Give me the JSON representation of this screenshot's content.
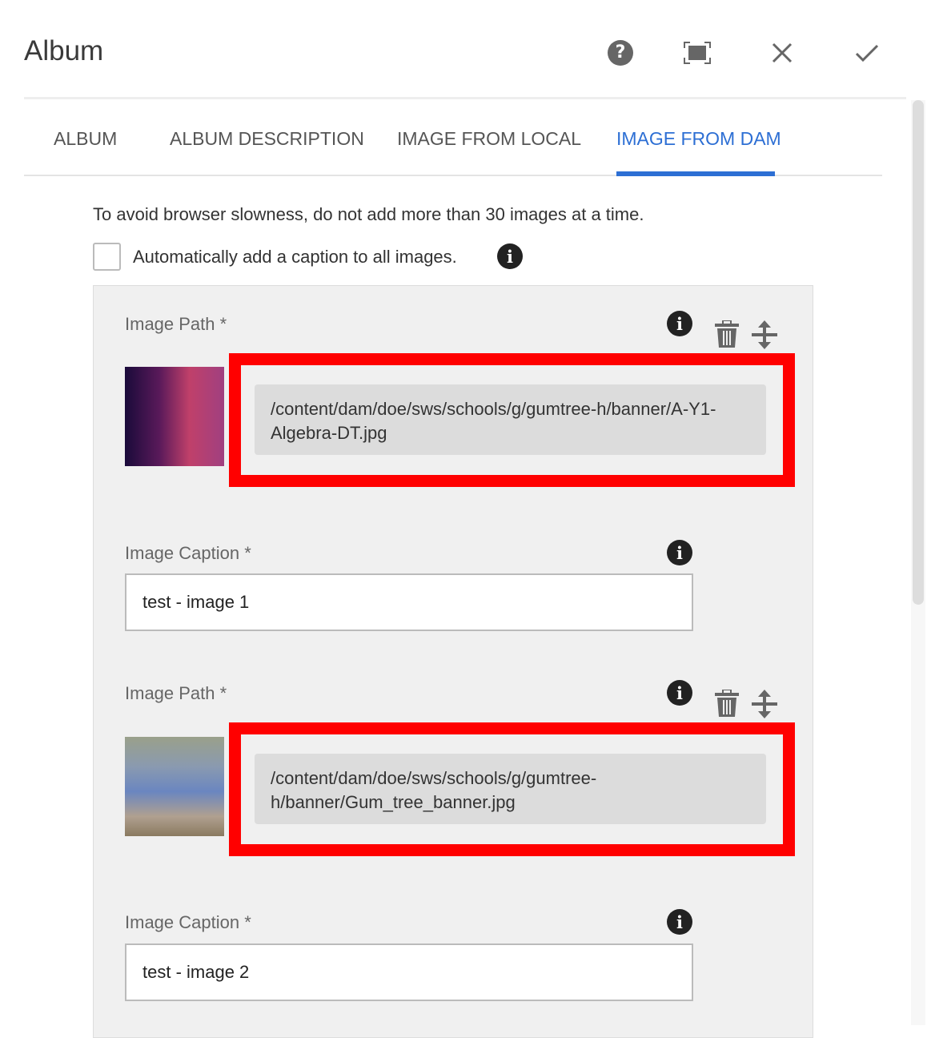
{
  "dialog": {
    "title": "Album",
    "actions": [
      "help-icon",
      "fullscreen-icon",
      "close-icon",
      "done-icon"
    ]
  },
  "tabs": [
    {
      "label": "ALBUM"
    },
    {
      "label": "ALBUM DESCRIPTION"
    },
    {
      "label": "IMAGE FROM LOCAL"
    },
    {
      "label": "IMAGE FROM DAM",
      "active": true
    }
  ],
  "note": "To avoid browser slowness, do not add more than 30 images at a time.",
  "auto_caption": {
    "label": "Automatically add a caption to all images.",
    "checked": false
  },
  "items": [
    {
      "path_label": "Image Path *",
      "path": "/content/dam/doe/sws/schools/g/gumtree-h/banner/A-Y1-Algebra-DT.jpg",
      "caption_label": "Image Caption *",
      "caption": "test - image 1"
    },
    {
      "path_label": "Image Path *",
      "path": "/content/dam/doe/sws/schools/g/gumtree-h/banner/Gum_tree_banner.jpg",
      "caption_label": "Image Caption *",
      "caption": "test - image 2"
    }
  ],
  "colors": {
    "accent": "#2d6fd4",
    "highlight": "#ff0000"
  }
}
